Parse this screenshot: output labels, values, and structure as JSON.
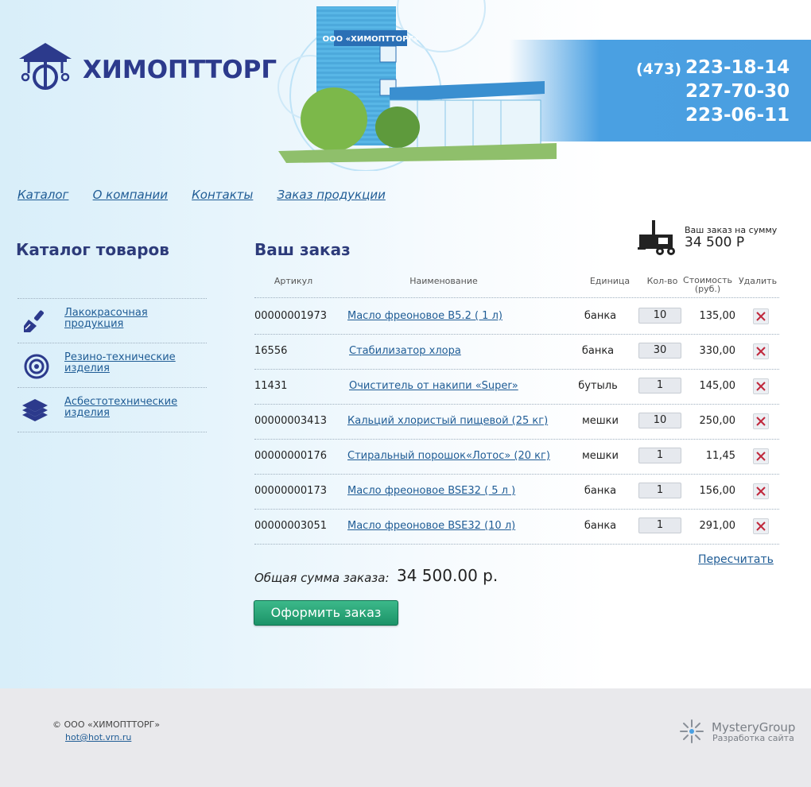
{
  "header": {
    "logo_text": "ХИМОПТТОРГ",
    "building_sign": "ООО «ХИМОПТТОРГ»",
    "phone_code": "(473)",
    "phones": [
      "223-18-14",
      "227-70-30",
      "223-06-11"
    ]
  },
  "nav": [
    "Каталог",
    "О компании",
    "Контакты",
    "Заказ продукции"
  ],
  "sidebar": {
    "title": "Каталог товаров",
    "items": [
      {
        "label": "Лакокрасочная продукция",
        "icon": "paint-brush-icon"
      },
      {
        "label": "Резино-технические изделия",
        "icon": "rubber-hose-icon"
      },
      {
        "label": "Асбестотехнические изделия",
        "icon": "layers-icon"
      }
    ]
  },
  "order": {
    "title": "Ваш заказ",
    "cart_label": "Ваш заказ на сумму",
    "cart_sum": "34 500 Р",
    "columns": {
      "article": "Артикул",
      "name": "Наименование",
      "unit": "Единица",
      "qty": "Кол-во",
      "cost": "Стоимость (руб.)",
      "delete": "Удалить"
    },
    "rows": [
      {
        "article": "00000001973",
        "name": "Масло фреоновое В5.2 ( 1 л)",
        "unit": "банка",
        "qty": "10",
        "cost": "135,00"
      },
      {
        "article": "16556",
        "name": "Стабилизатор хлора",
        "unit": "банка",
        "qty": "30",
        "cost": "330,00"
      },
      {
        "article": "11431",
        "name": "Очиститель от накипи «Super»",
        "unit": "бутыль",
        "qty": "1",
        "cost": "145,00"
      },
      {
        "article": "00000003413",
        "name": "Кальций хлористый пищевой (25 кг)",
        "unit": "мешки",
        "qty": "10",
        "cost": "250,00"
      },
      {
        "article": "00000000176",
        "name": "Стиральный порошок«Лотос» (20 кг)",
        "unit": "мешки",
        "qty": "1",
        "cost": "11,45"
      },
      {
        "article": "00000000173",
        "name": "Масло фреоновое BSE32 ( 5 л )",
        "unit": "банка",
        "qty": "1",
        "cost": "156,00"
      },
      {
        "article": "00000003051",
        "name": "Масло фреоновое BSE32 (10 л)",
        "unit": "банка",
        "qty": "1",
        "cost": "291,00"
      }
    ],
    "recalc_label": "Пересчитать",
    "total_label": "Общая сумма заказа:",
    "total_value": "34 500.00 р.",
    "checkout_label": "Оформить заказ"
  },
  "footer": {
    "copyright": "© ООО «ХИМОПТТОРГ»",
    "email": "hot@hot.vrn.ru",
    "dev_name": "MysteryGroup",
    "dev_sub": "Разработка сайта"
  },
  "colors": {
    "accent_blue": "#4aa0e2",
    "title_navy": "#2d3b7a",
    "link": "#1f5c95",
    "button_green": "#1c9368",
    "delete_red": "#c0283c"
  }
}
